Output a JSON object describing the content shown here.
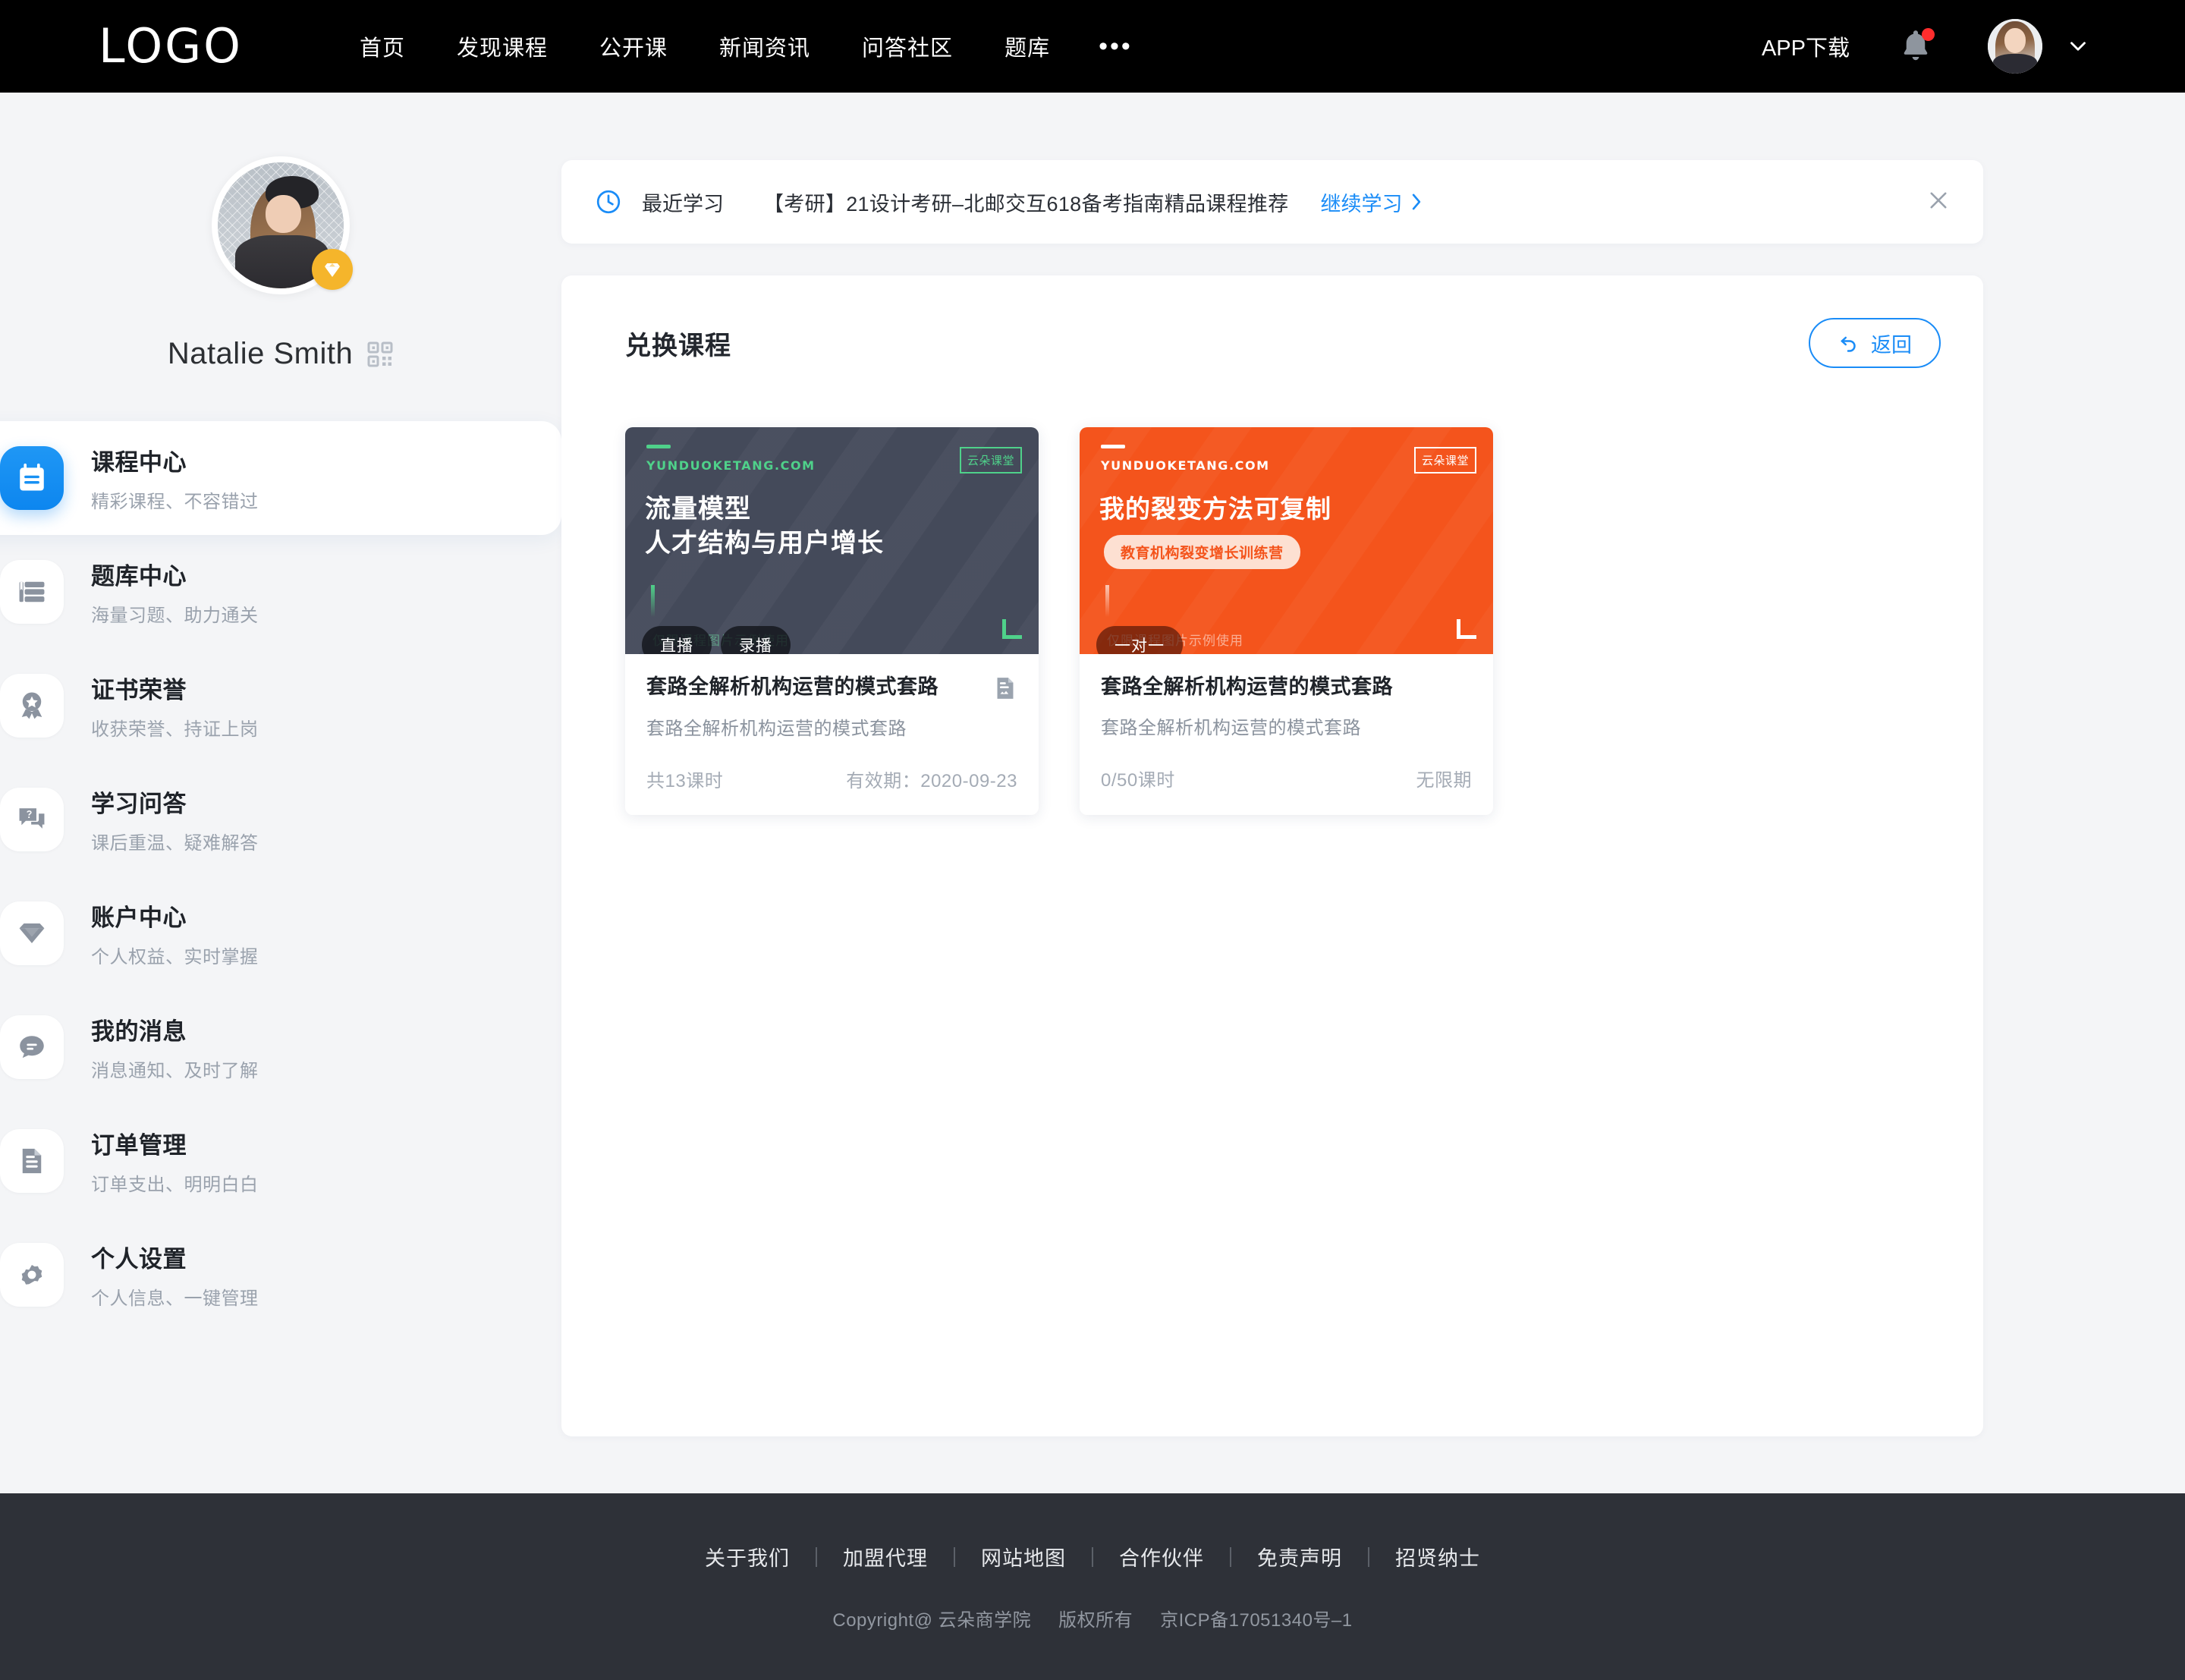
{
  "header": {
    "logo": "LOGO",
    "nav": [
      {
        "label": "首页"
      },
      {
        "label": "发现课程"
      },
      {
        "label": "公开课"
      },
      {
        "label": "新闻资讯"
      },
      {
        "label": "问答社区"
      },
      {
        "label": "题库"
      }
    ],
    "more": "•••",
    "app_download": "APP下载",
    "notification_has_badge": true
  },
  "sidebar": {
    "user_name": "Natalie Smith",
    "vip_badge": "diamond",
    "items": [
      {
        "label": "课程中心",
        "sub": "精彩课程、不容错过",
        "icon": "calendar-icon",
        "active": true
      },
      {
        "label": "题库中心",
        "sub": "海量习题、助力通关",
        "icon": "book-list-icon",
        "active": false
      },
      {
        "label": "证书荣誉",
        "sub": "收获荣誉、持证上岗",
        "icon": "medal-icon",
        "active": false
      },
      {
        "label": "学习问答",
        "sub": "课后重温、疑难解答",
        "icon": "question-bubble-icon",
        "active": false
      },
      {
        "label": "账户中心",
        "sub": "个人权益、实时掌握",
        "icon": "diamond-icon",
        "active": false
      },
      {
        "label": "我的消息",
        "sub": "消息通知、及时了解",
        "icon": "chat-bubble-icon",
        "active": false
      },
      {
        "label": "订单管理",
        "sub": "订单支出、明明白白",
        "icon": "document-icon",
        "active": false
      },
      {
        "label": "个人设置",
        "sub": "个人信息、一键管理",
        "icon": "gear-icon",
        "active": false
      }
    ]
  },
  "banner": {
    "icon": "clock-icon",
    "label": "最近学习",
    "title": "【考研】21设计考研–北邮交互618备考指南精品课程推荐",
    "cta": "继续学习",
    "cta_arrow": "›",
    "close": "×"
  },
  "panel": {
    "title": "兑换课程",
    "back_label": "返回",
    "back_icon": "undo-arrow-icon"
  },
  "courses": [
    {
      "theme": "dark",
      "cover_domain": "YUNDUOKETANG.COM",
      "cover_brand": "云朵课堂",
      "cover_heading_line1": "流量模型",
      "cover_heading_line2": "人才结构与用户增长",
      "cover_pill": "",
      "watermark": "仅限课程图片示例使用",
      "tags": [
        "直播",
        "录播"
      ],
      "title": "套路全解析机构运营的模式套路",
      "subtitle": "套路全解析机构运营的模式套路",
      "lessons": "共13课时",
      "validity": "有效期：2020-09-23",
      "has_file_icon": true,
      "accent_color": "#4fd18a",
      "bg_color": "#444a5a"
    },
    {
      "theme": "orange",
      "cover_domain": "YUNDUOKETANG.COM",
      "cover_brand": "云朵课堂",
      "cover_heading_line1": "我的裂变方法可复制",
      "cover_heading_line2": "",
      "cover_pill": "教育机构裂变增长训练营",
      "watermark": "仅限课程图片示例使用",
      "tags": [
        "一对一"
      ],
      "title": "套路全解析机构运营的模式套路",
      "subtitle": "套路全解析机构运营的模式套路",
      "lessons": "0/50课时",
      "validity": "无限期",
      "has_file_icon": false,
      "accent_color": "#ffffff",
      "bg_color": "#f4541c"
    }
  ],
  "footer": {
    "links": [
      {
        "label": "关于我们"
      },
      {
        "label": "加盟代理"
      },
      {
        "label": "网站地图"
      },
      {
        "label": "合作伙伴"
      },
      {
        "label": "免责声明"
      },
      {
        "label": "招贤纳士"
      }
    ],
    "copyright": "Copyright@ 云朵商学院",
    "rights": "版权所有",
    "icp": "京ICP备17051340号–1"
  },
  "colors": {
    "brand_blue": "#1a8cf7",
    "active_icon_blue": "#0d86ef",
    "vip_gold": "#f5b52b",
    "notification_red": "#ff2d2d",
    "page_bg": "#f4f5f7",
    "footer_bg": "#2e3138"
  }
}
